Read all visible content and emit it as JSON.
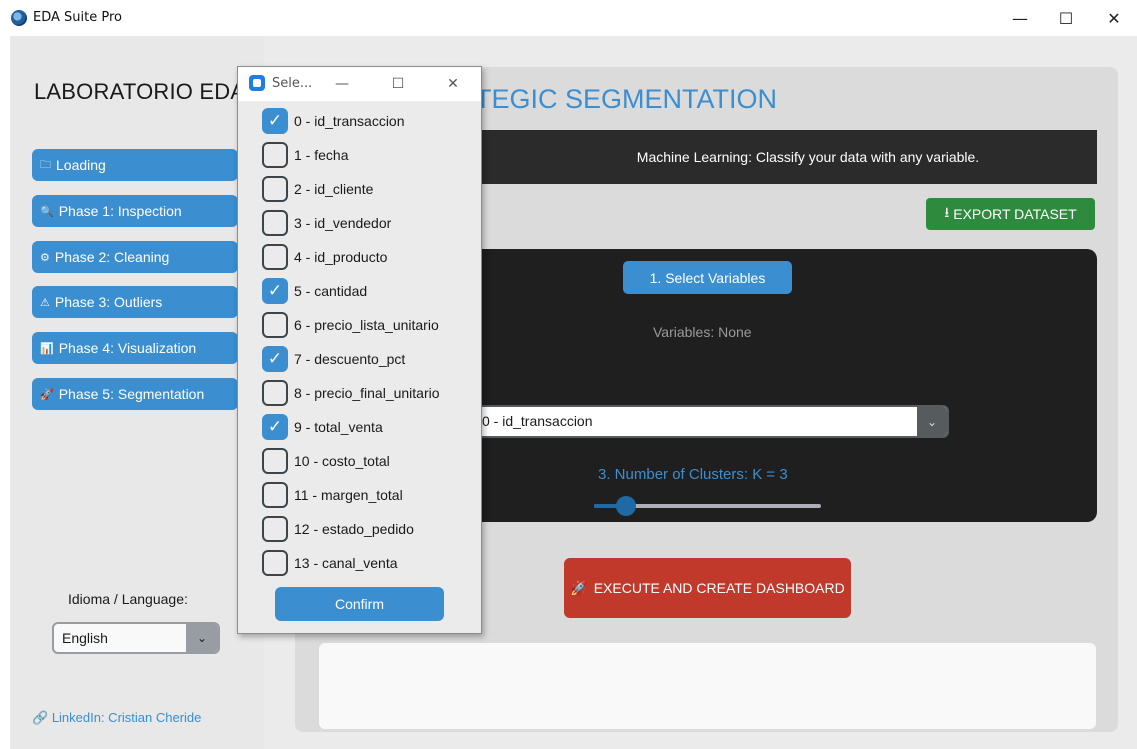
{
  "window": {
    "title": "EDA Suite Pro",
    "minimize": "—",
    "maximize": "☐",
    "close": "✕"
  },
  "sidebar": {
    "title": "LABORATORIO EDA",
    "items": [
      {
        "icon": "🗀",
        "label": "Loading"
      },
      {
        "icon": "🔍",
        "label": "Phase 1: Inspection"
      },
      {
        "icon": "⚙",
        "label": "Phase 2: Cleaning"
      },
      {
        "icon": "⚠",
        "label": "Phase 3: Outliers"
      },
      {
        "icon": "📊",
        "label": "Phase 4: Visualization"
      },
      {
        "icon": "🚀",
        "label": "Phase 5: Segmentation"
      }
    ],
    "language_label": "Idioma / Language:",
    "language_value": "English",
    "linkedin": "LinkedIn: Cristian Cheride"
  },
  "main": {
    "title": "STRATEGIC SEGMENTATION",
    "banner": "Machine Learning: Classify your data with any variable.",
    "export_button": "EXPORT DATASET",
    "select_variables_button": "1. Select Variables",
    "variables_status": "Variables: None",
    "target_value": "0 - id_transaccion",
    "clusters_label": "3. Number of Clusters: K = 3",
    "clusters_k": 3,
    "slider_fraction": 0.14,
    "execute_button": "EXECUTE AND CREATE DASHBOARD",
    "output_text": ""
  },
  "popup": {
    "title": "Sele...",
    "minimize": "—",
    "maximize": "☐",
    "close": "✕",
    "options": [
      {
        "label": "0 - id_transaccion",
        "checked": true
      },
      {
        "label": "1 - fecha",
        "checked": false
      },
      {
        "label": "2 - id_cliente",
        "checked": false
      },
      {
        "label": "3 - id_vendedor",
        "checked": false
      },
      {
        "label": "4 - id_producto",
        "checked": false
      },
      {
        "label": "5 - cantidad",
        "checked": true
      },
      {
        "label": "6 - precio_lista_unitario",
        "checked": false
      },
      {
        "label": "7 - descuento_pct",
        "checked": true
      },
      {
        "label": "8 - precio_final_unitario",
        "checked": false
      },
      {
        "label": "9 - total_venta",
        "checked": true
      },
      {
        "label": "10 - costo_total",
        "checked": false
      },
      {
        "label": "11 - margen_total",
        "checked": false
      },
      {
        "label": "12 - estado_pedido",
        "checked": false
      },
      {
        "label": "13 - canal_venta",
        "checked": false
      }
    ],
    "confirm_button": "Confirm"
  },
  "colors": {
    "accent": "#3b8ed0",
    "success": "#2e8b3e",
    "danger": "#c0392b",
    "panel_dark": "#1f1f1f"
  }
}
